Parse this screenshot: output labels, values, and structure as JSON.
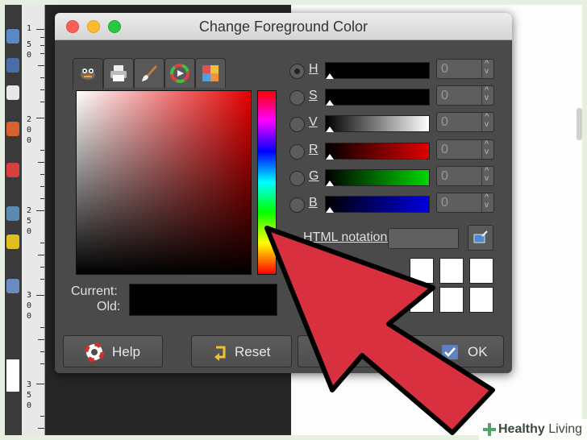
{
  "dialog": {
    "title": "Change Foreground Color"
  },
  "ruler": {
    "labels": [
      "1",
      "5",
      "0",
      "2",
      "0",
      "0",
      "2",
      "5",
      "0",
      "3",
      "0",
      "0",
      "3",
      "5",
      "0"
    ]
  },
  "selector_tabs": [
    {
      "name": "gimp",
      "icon": "gimp-icon"
    },
    {
      "name": "cmyk",
      "icon": "printer-icon"
    },
    {
      "name": "watercolor",
      "icon": "paintbrush-icon"
    },
    {
      "name": "wheel",
      "icon": "color-wheel-icon"
    },
    {
      "name": "palette",
      "icon": "palette-icon"
    }
  ],
  "labels": {
    "current": "Current:",
    "old": "Old:",
    "hex_notation": "HTML notation:"
  },
  "channels": [
    {
      "letter": "H",
      "value": "0",
      "selected": true
    },
    {
      "letter": "S",
      "value": "0",
      "selected": false
    },
    {
      "letter": "V",
      "value": "0",
      "selected": false
    },
    {
      "letter": "R",
      "value": "0",
      "selected": false
    },
    {
      "letter": "G",
      "value": "0",
      "selected": false
    },
    {
      "letter": "B",
      "value": "0",
      "selected": false
    }
  ],
  "colors": {
    "current": "#000000",
    "pointer_arrow": "#d93040",
    "slider_r": "#e00000",
    "slider_g": "#00d800",
    "slider_b": "#0000e0"
  },
  "buttons": {
    "help": "Help",
    "reset": "Reset",
    "ok": "OK"
  },
  "watermark": {
    "part1": "Healthy",
    "part2": "Living"
  }
}
